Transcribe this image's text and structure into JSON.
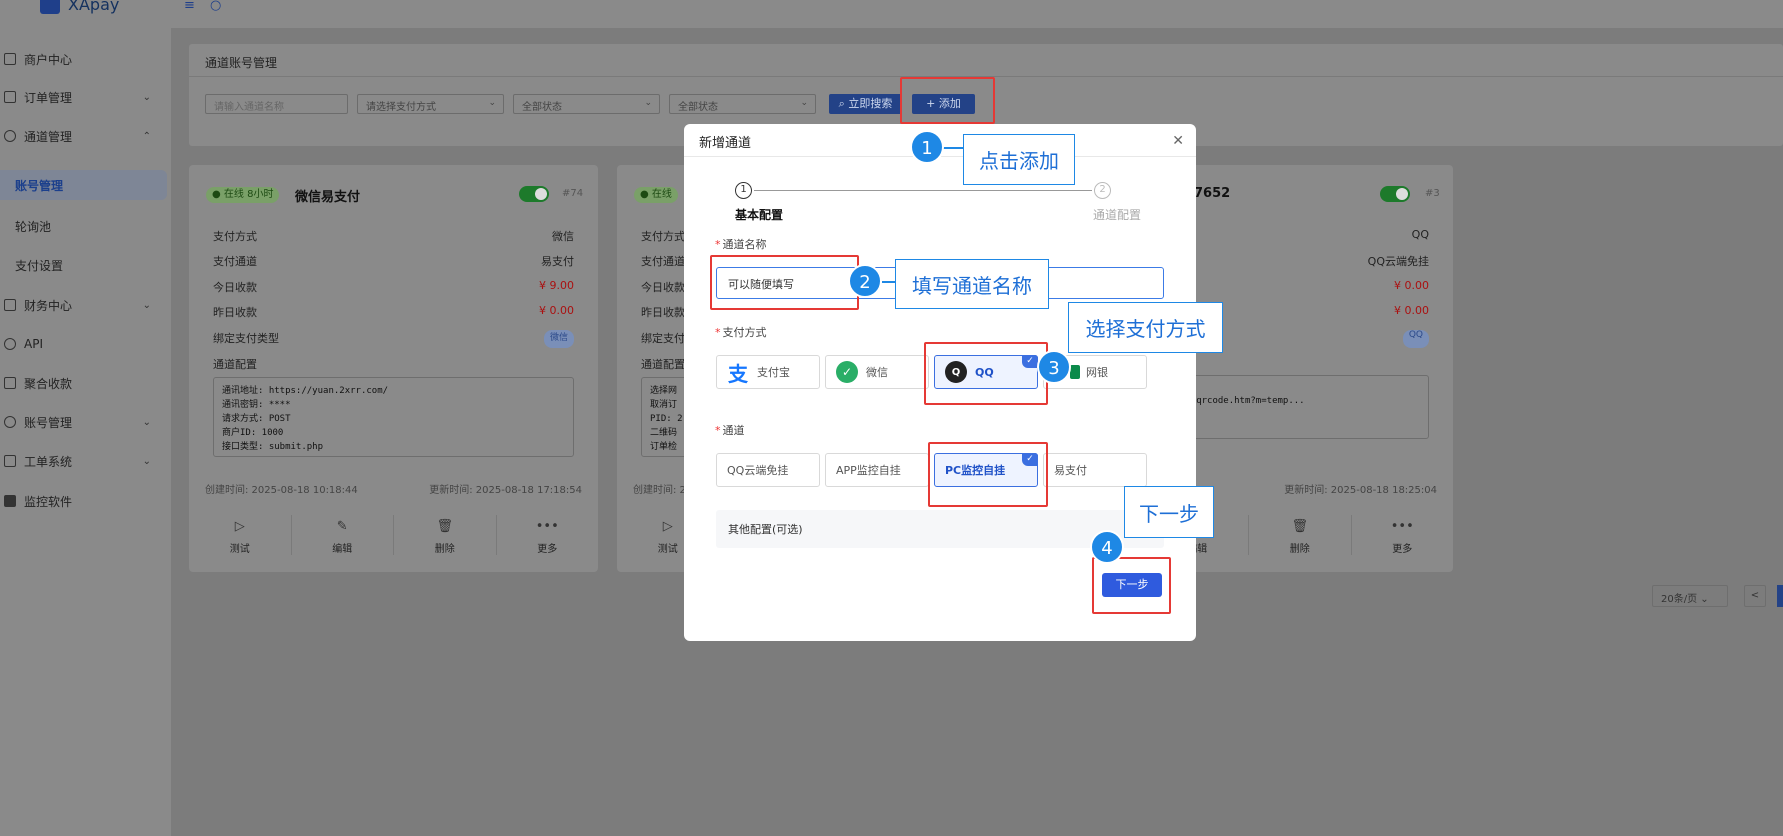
{
  "app": {
    "name": "XApay"
  },
  "sidebar": {
    "items": [
      {
        "label": "商户中心"
      },
      {
        "label": "订单管理"
      },
      {
        "label": "通道管理"
      },
      {
        "label": "账号管理"
      },
      {
        "label": "轮询池"
      },
      {
        "label": "支付设置"
      },
      {
        "label": "财务中心"
      },
      {
        "label": "API"
      },
      {
        "label": "聚合收款"
      },
      {
        "label": "账号管理"
      },
      {
        "label": "工单系统"
      },
      {
        "label": "监控软件"
      }
    ]
  },
  "page": {
    "title": "通道账号管理",
    "filters": {
      "name_placeholder": "请输入通道名称",
      "paytype_placeholder": "请选择支付方式",
      "status1": "全部状态",
      "status2": "全部状态",
      "search_label": "立即搜索",
      "add_label": "+ 添加"
    }
  },
  "cards": [
    {
      "status": "在线 8小时",
      "name": "微信易支付",
      "id": "#74",
      "fields": [
        {
          "k": "支付方式",
          "v": "微信"
        },
        {
          "k": "支付通道",
          "v": "易支付"
        },
        {
          "k": "今日收款",
          "v": "¥ 9.00"
        },
        {
          "k": "昨日收款",
          "v": "¥ 0.00"
        },
        {
          "k": "绑定支付类型",
          "v": "微信"
        },
        {
          "k": "通道配置",
          "v": ""
        }
      ],
      "config": "通讯地址: https://yuan.2xrr.com/\n通讯密钥: ****\n请求方式: POST\n商户ID: 1000\n接口类型: submit.php",
      "created": "创建时间: 2025-08-18 10:18:44",
      "updated": "更新时间: 2025-08-18 17:18:54"
    },
    {
      "status": "在线",
      "name": "",
      "fields": [
        {
          "k": "支付方式"
        },
        {
          "k": "支付通道"
        },
        {
          "k": "今日收款"
        },
        {
          "k": "昨日收款"
        },
        {
          "k": "绑定支付类型"
        },
        {
          "k": "通道配置"
        }
      ],
      "config": "选择网\n取消订\nPID: 2\n二维码\n订单检",
      "created": "创建时间: 2"
    },
    {
      "name_fragment": "7652",
      "id": "#3",
      "fields": [
        {
          "v": "QQ"
        },
        {
          "v": "QQ云端免挂"
        },
        {
          "v": "¥ 0.00"
        },
        {
          "v": "¥ 0.00"
        },
        {
          "v": "QQ"
        }
      ],
      "config": "ianbao.qq.com/wallet/sqrcode.htm?m=temp...",
      "updated": "更新时间: 2025-08-18 18:25:04"
    }
  ],
  "card_actions": [
    "测试",
    "编辑",
    "删除",
    "更多"
  ],
  "pagination": {
    "page_size": "20条/页",
    "prev": "<"
  },
  "modal": {
    "title": "新增通道",
    "steps": [
      {
        "num": "1",
        "label": "基本配置"
      },
      {
        "num": "2",
        "label": "通道配置"
      }
    ],
    "name_label": "通道名称",
    "name_value": "可以随便填写",
    "paytype_label": "支付方式",
    "paytypes": [
      {
        "label": "支付宝",
        "icon": "alipay-icon",
        "selected": false
      },
      {
        "label": "微信",
        "icon": "wechat-icon",
        "selected": false
      },
      {
        "label": "QQ",
        "icon": "qq-icon",
        "selected": true
      },
      {
        "label": "网银",
        "icon": "bank-icon",
        "selected": false
      }
    ],
    "channel_label": "通道",
    "channels": [
      {
        "label": "QQ云端免挂",
        "selected": false
      },
      {
        "label": "APP监控自挂",
        "selected": false
      },
      {
        "label": "PC监控自挂",
        "selected": true
      },
      {
        "label": "易支付",
        "selected": false
      }
    ],
    "other_label": "其他配置(可选)",
    "next_label": "下一步"
  },
  "annotations": [
    {
      "num": "1",
      "text": "点击添加"
    },
    {
      "num": "2",
      "text": "填写通道名称"
    },
    {
      "num": "3",
      "text": "选择支付方式"
    },
    {
      "num": "4",
      "text": "下一步"
    }
  ],
  "colors": {
    "primary": "#2f5bde",
    "annotation_red": "#e53935",
    "annotation_blue": "#1e88e5"
  }
}
